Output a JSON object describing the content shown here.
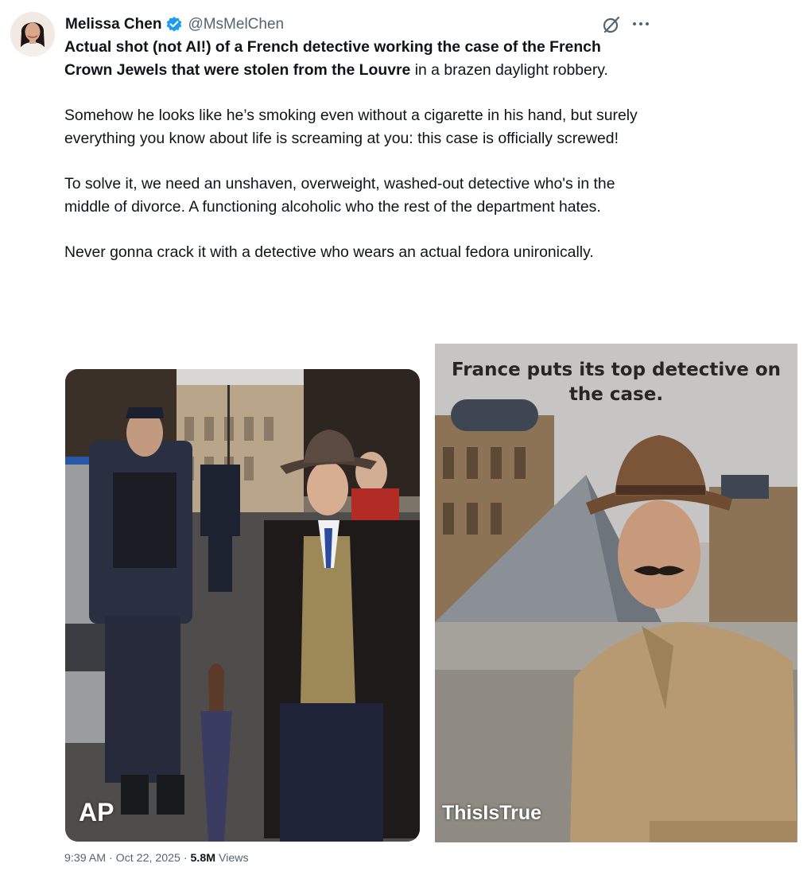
{
  "author": {
    "name": "Melissa Chen",
    "handle": "@MsMelChen",
    "verified": true,
    "verified_color": "#1d9bf0"
  },
  "icons": {
    "verified": "verified-badge-icon",
    "grok": "grok-icon",
    "more": "more-options-icon"
  },
  "tweet": {
    "p1_bold": "Actual shot (not AI!) of a French detective working the case of the French Crown Jewels that were stolen from the Louvre",
    "p1_rest": " in a brazen daylight robbery.",
    "p2": "Somehow he looks like he’s smoking even without a cigarette in his hand, but surely everything you know about life is screaming at you: this case is officially screwed!",
    "p3": "To solve it, we need an unshaven, overweight, washed-out detective who's in the middle of divorce. A functioning alcoholic who the rest of the department hates.",
    "p4": "Never gonna crack it with a detective who wears an actual fedora unironically."
  },
  "media": {
    "left_watermark": "AP",
    "right_caption": "France puts its top detective on the case.",
    "right_watermark": "ThisIsTrue"
  },
  "meta": {
    "time": "9:39 AM",
    "sep1": " · ",
    "date": "Oct 22, 2025",
    "sep2": " · ",
    "views_count": "5.8M",
    "views_label": " Views"
  }
}
